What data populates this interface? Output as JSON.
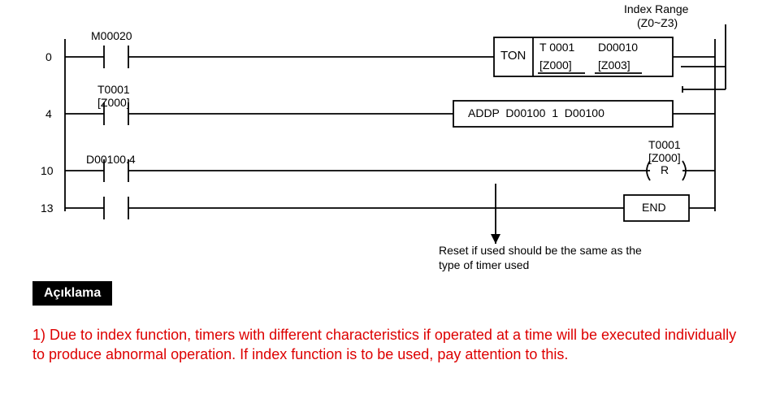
{
  "header": {
    "index_range_l1": "Index Range",
    "index_range_l2": "(Z0~Z3)"
  },
  "rungs": {
    "r0": {
      "num": "0",
      "contact": "M00020",
      "box_label": "TON",
      "box_line1_a": "T 0001",
      "box_line1_b": "D00010",
      "box_line2_a": "[Z000]",
      "box_line2_b": "[Z003]"
    },
    "r4": {
      "num": "4",
      "contact_l1": "T0001",
      "contact_l2": "[Z000]",
      "box_text": "ADDP  D00100  1  D00100"
    },
    "r10": {
      "num": "10",
      "contact": "D00100.4",
      "coil_l1": "T0001",
      "coil_l2": "[Z000]",
      "coil_sym": "R"
    },
    "r13": {
      "num": "13",
      "box_text": "END"
    }
  },
  "note": {
    "l1": "Reset if used should be the same as the",
    "l2": "type of timer used"
  },
  "desc": {
    "title": "Açıklama",
    "body": "1) Due to index function, timers with different characteristics if operated at a time will be executed individually to produce abnormal operation. If index function is to be used, pay attention to this."
  }
}
